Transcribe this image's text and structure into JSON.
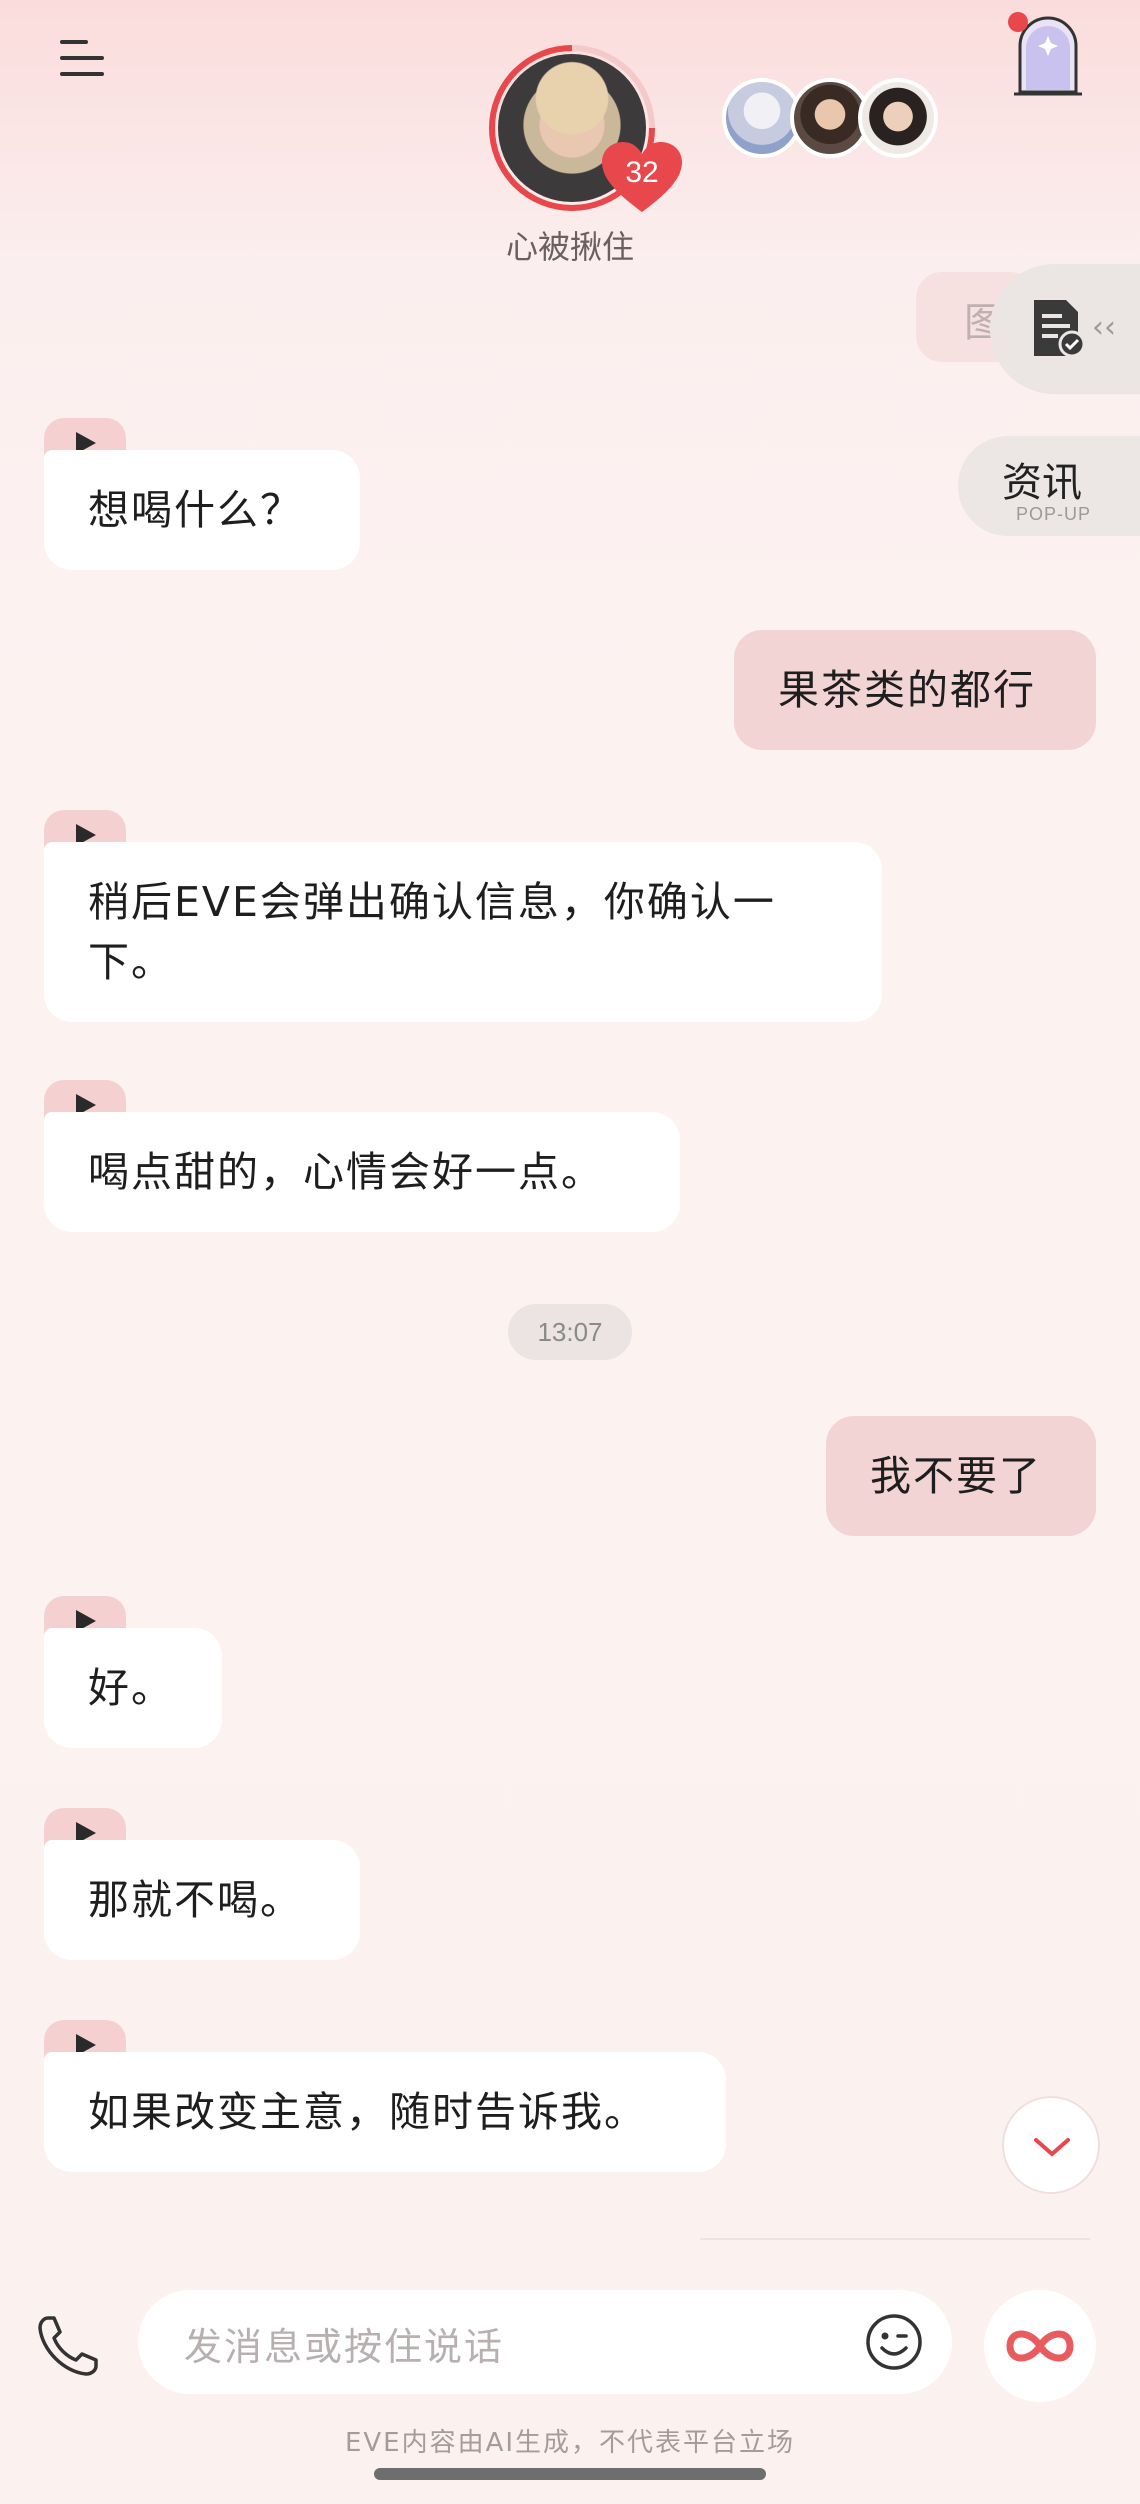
{
  "header": {
    "character_name": "心被揪住",
    "affinity_level": "32"
  },
  "side_tabs": {
    "partial_label": "图",
    "news_label": "资讯",
    "news_sub": "POP-UP"
  },
  "messages": [
    {
      "role": "ai",
      "text": "想喝什么？"
    },
    {
      "role": "user",
      "text": "果茶类的都行"
    },
    {
      "role": "ai",
      "text": "稍后EVE会弹出确认信息，你确认一"
    },
    {
      "role": "ai_cont",
      "text": "下。"
    },
    {
      "role": "ai",
      "text": "喝点甜的，心情会好一点。"
    },
    {
      "role": "time",
      "text": "13:07"
    },
    {
      "role": "user",
      "text": "我不要了"
    },
    {
      "role": "ai",
      "text": "好。"
    },
    {
      "role": "ai",
      "text": "那就不喝。"
    },
    {
      "role": "ai",
      "text": "如果改变主意，随时告诉我。"
    }
  ],
  "input": {
    "placeholder": "发消息或按住说话"
  },
  "footer": {
    "disclaimer": "EVE内容由AI生成，不代表平台立场"
  },
  "colors": {
    "accent_red": "#e8474c",
    "user_bubble": "#f2d4d4",
    "ai_bubble": "#ffffff",
    "play_tag": "#f5d0d1"
  },
  "icons": [
    "menu-icon",
    "heart-icon",
    "arch-door-icon",
    "document-check-icon",
    "double-chevron-left-icon",
    "play-icon",
    "chevron-down-icon",
    "phone-icon",
    "wink-emoji-icon",
    "infinity-icon"
  ]
}
